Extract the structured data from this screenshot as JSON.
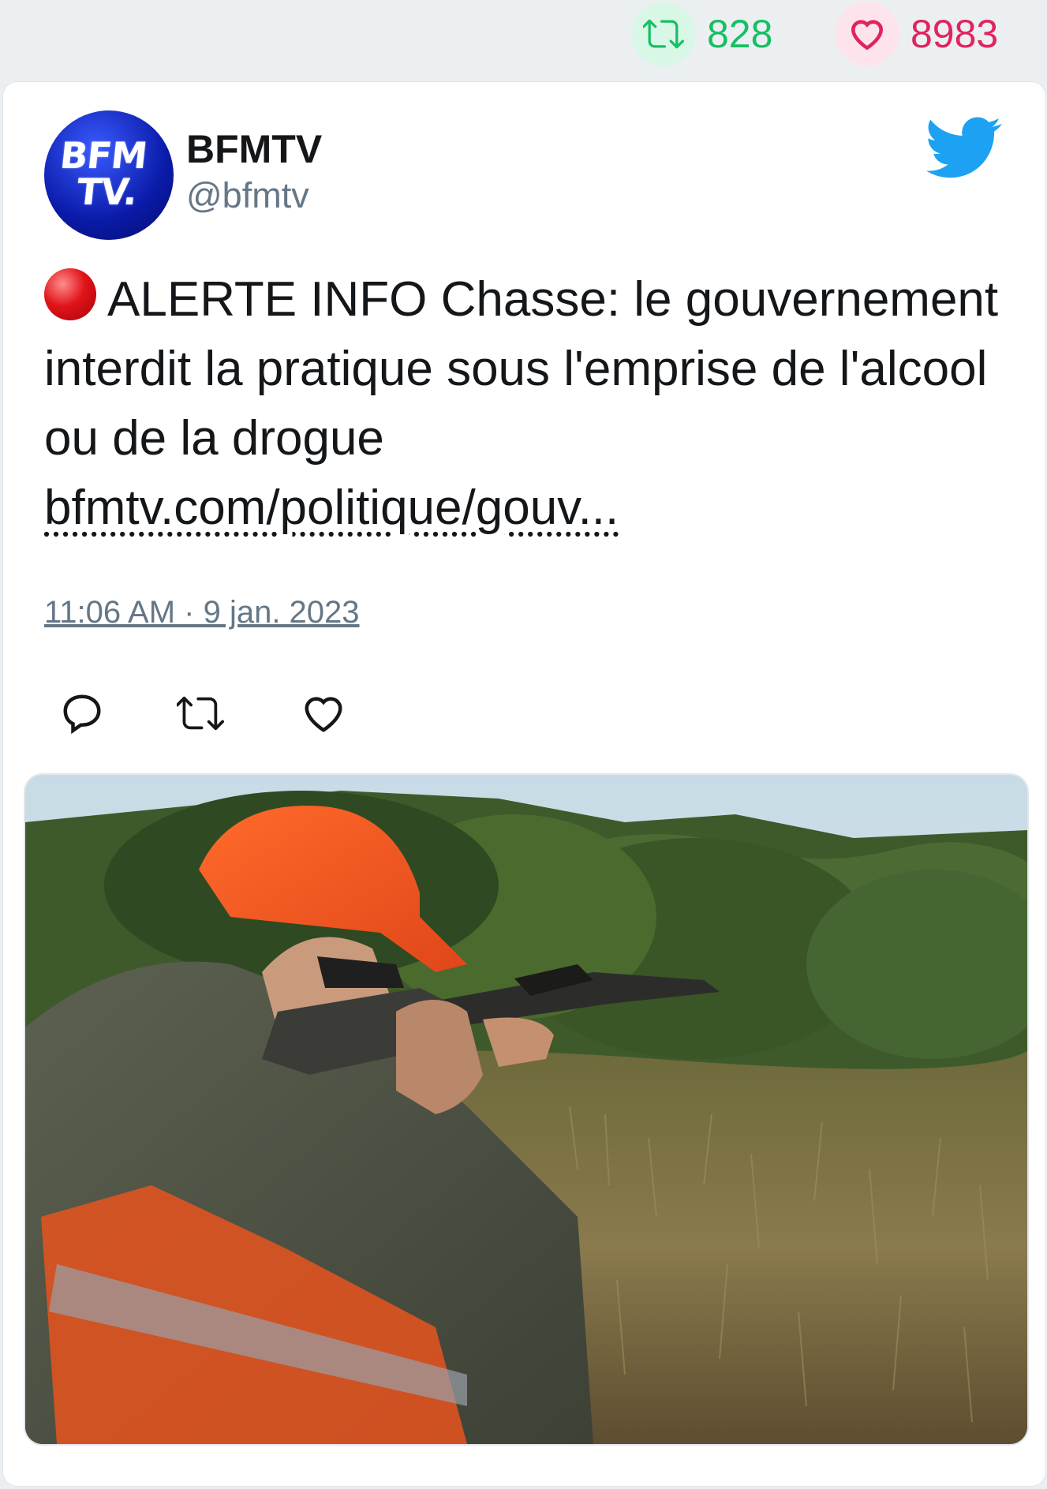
{
  "stats": {
    "retweet_count": "828",
    "like_count": "8983"
  },
  "tweet": {
    "author_name": "BFMTV",
    "author_handle": "@bfmtv",
    "avatar_text_line1": "BFM",
    "avatar_text_line2": "TV.",
    "text": "ALERTE INFO Chasse: le gouvernement interdit la pratique sous l'emprise de l'alcool ou de la drogue",
    "link": "bfmtv.com/politique/gouv...",
    "timestamp": "11:06 AM · 9 jan. 2023",
    "media_alt": "Photo: hunter in orange cap aiming a rifle in scrubland"
  },
  "icons": {
    "retweet_stat": "retweet-icon",
    "like_stat": "heart-icon",
    "brand": "twitter-bird-icon",
    "reply_action": "reply-icon",
    "retweet_action": "retweet-icon",
    "like_action": "heart-icon",
    "alert": "red-circle-icon"
  },
  "colors": {
    "retweet": "#17bf63",
    "like": "#e0245e",
    "twitter_blue": "#1da1f2",
    "secondary_text": "#657786"
  }
}
